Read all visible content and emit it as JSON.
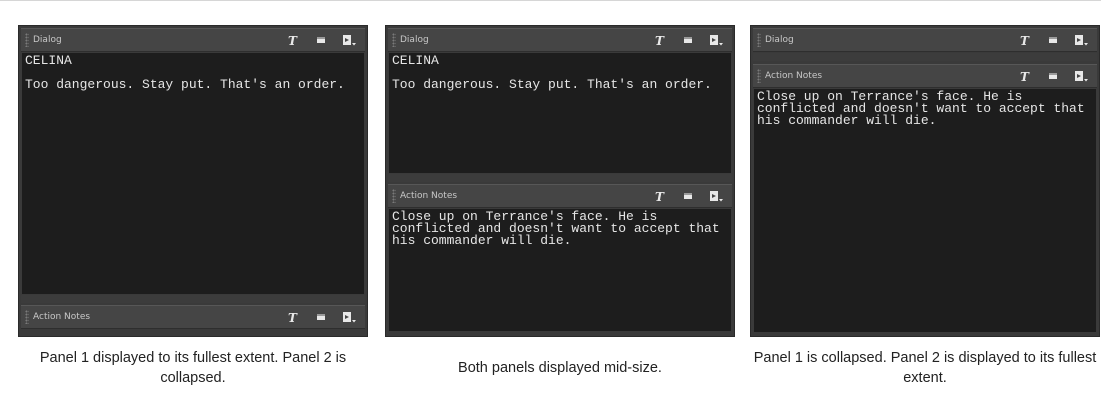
{
  "examples": [
    {
      "panel_top": {
        "title": "Dialog",
        "text_heading": "CELINA",
        "text_body": "Too dangerous. Stay put. That's an order."
      },
      "panel_bottom": {
        "title": "Action Notes"
      },
      "caption": "Panel 1 displayed to its fullest extent. Panel 2 is collapsed."
    },
    {
      "panel_top": {
        "title": "Dialog",
        "text_heading": "CELINA",
        "text_body": "Too dangerous. Stay put. That's an order."
      },
      "panel_bottom": {
        "title": "Action Notes",
        "text_body": "Close up on Terrance's face. He is conflicted and doesn't want to accept that his commander will die."
      },
      "caption": "Both panels displayed mid-size."
    },
    {
      "panel_top": {
        "title": "Dialog"
      },
      "panel_bottom": {
        "title": "Action Notes",
        "text_body": "Close up on Terrance's face. He is conflicted and doesn't want to accept that his commander will die."
      },
      "caption": "Panel 1 is collapsed. Panel 2 is displayed to its fullest extent."
    }
  ],
  "icons": [
    "text-format-icon",
    "panel-icon",
    "panel-menu-icon"
  ],
  "colors": {
    "panel_bg": "#3a3a3a",
    "header_bg": "#454545",
    "text_area_bg": "#1d1d1d",
    "text": "#e6e6e6"
  }
}
